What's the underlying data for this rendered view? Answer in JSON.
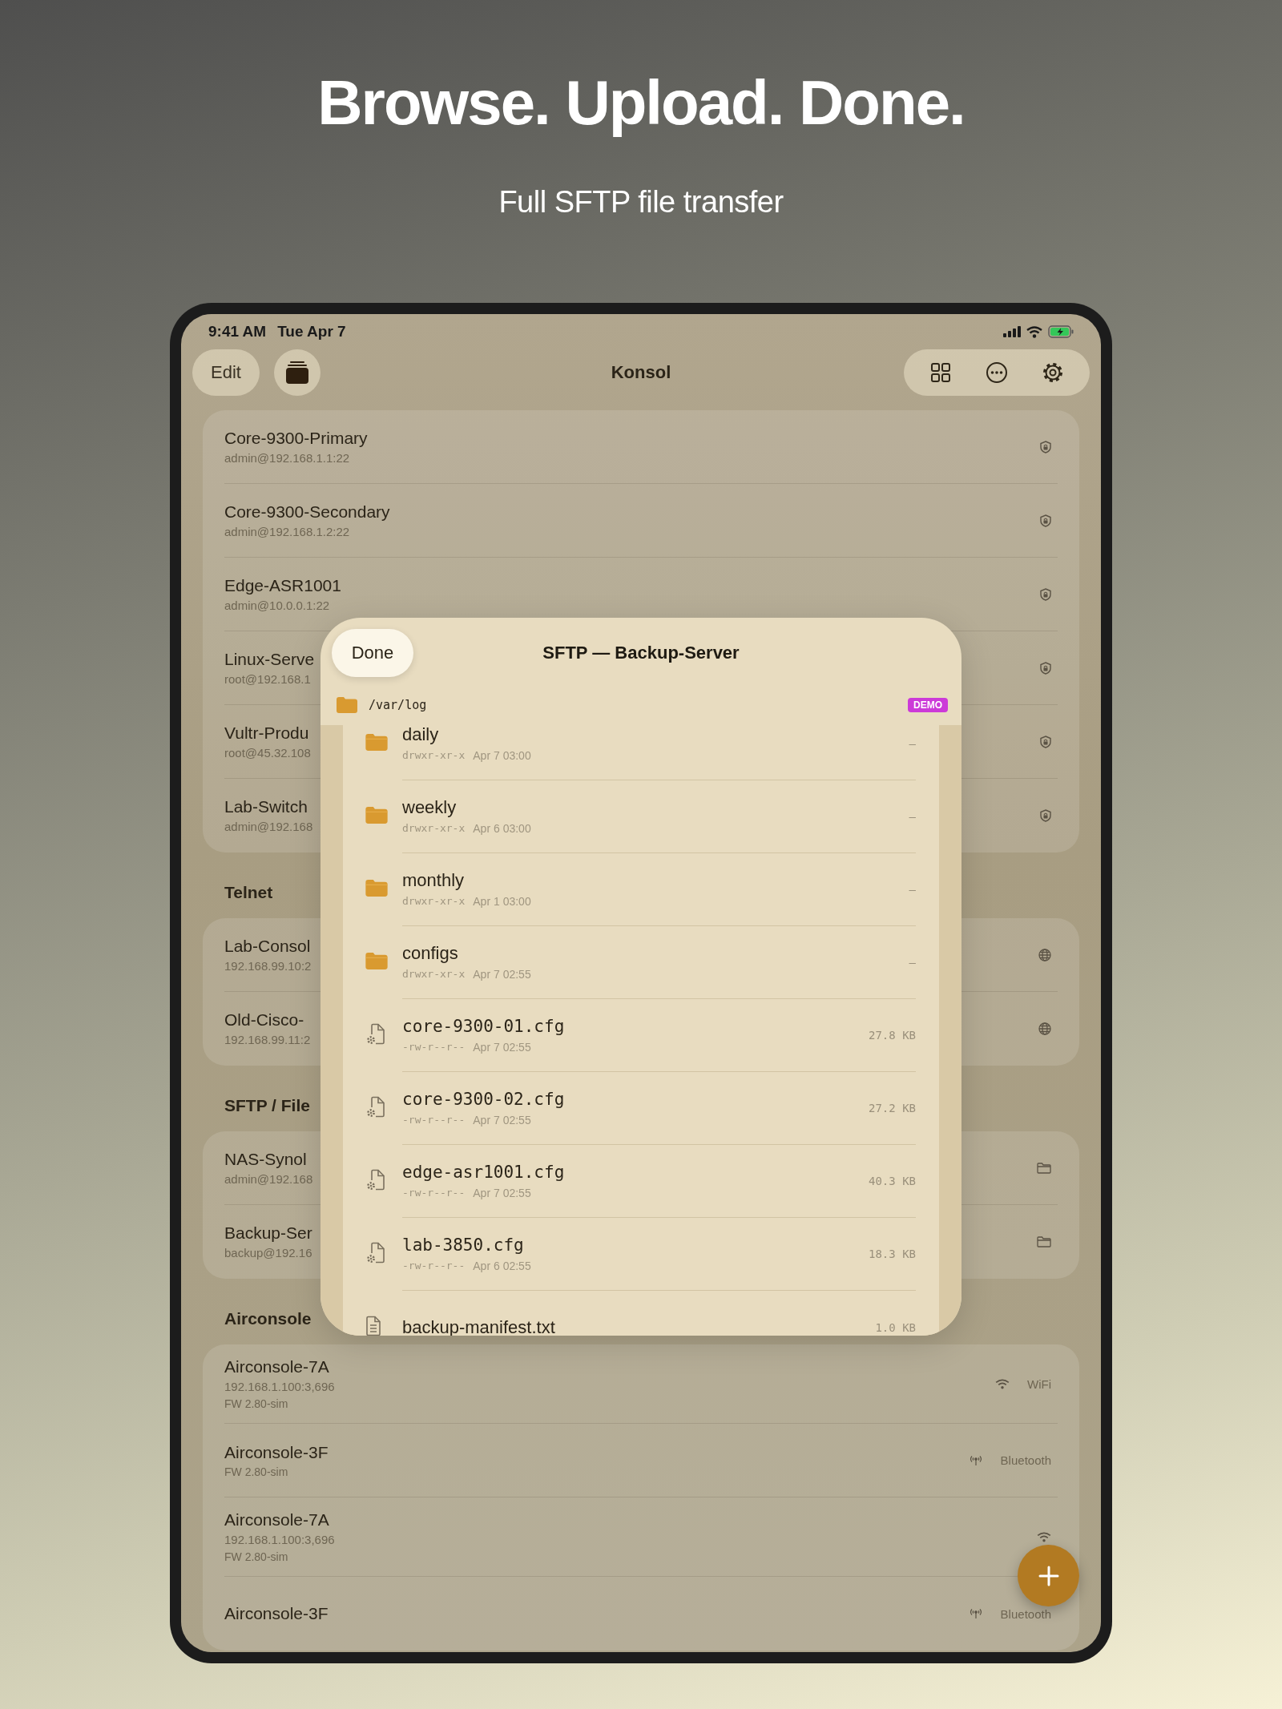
{
  "promo": {
    "headline": "Browse. Upload. Done.",
    "subtitle": "Full SFTP file transfer"
  },
  "status_bar": {
    "time": "9:41 AM",
    "date": "Tue Apr 7"
  },
  "nav_bar": {
    "edit_button": "Edit",
    "title": "Konsol"
  },
  "sections": [
    {
      "hosts": [
        {
          "name": "Core-9300-Primary",
          "address": "admin@192.168.1.1:22",
          "kind": "ssh"
        },
        {
          "name": "Core-9300-Secondary",
          "address": "admin@192.168.1.2:22",
          "kind": "ssh"
        },
        {
          "name": "Edge-ASR1001",
          "address": "admin@10.0.0.1:22",
          "kind": "ssh"
        },
        {
          "name": "Linux-Serve",
          "address": "root@192.168.1",
          "kind": "ssh"
        },
        {
          "name": "Vultr-Produ",
          "address": "root@45.32.108",
          "kind": "ssh"
        },
        {
          "name": "Lab-Switch",
          "address": "admin@192.168",
          "kind": "ssh"
        }
      ]
    },
    {
      "title": "Telnet",
      "hosts": [
        {
          "name": "Lab-Consol",
          "address": "192.168.99.10:2",
          "kind": "telnet"
        },
        {
          "name": "Old-Cisco-",
          "address": "192.168.99.11:2",
          "kind": "telnet"
        }
      ]
    },
    {
      "title": "SFTP / File",
      "hosts": [
        {
          "name": "NAS-Synol",
          "address": "admin@192.168",
          "kind": "sftp"
        },
        {
          "name": "Backup-Ser",
          "address": "backup@192.16",
          "kind": "sftp"
        }
      ]
    },
    {
      "title": "Airconsole",
      "hosts": [
        {
          "name": "Airconsole-7A",
          "address": "192.168.1.100:3,696",
          "firmware": "FW 2.80-sim",
          "kind": "wifi",
          "connection": "WiFi"
        },
        {
          "name": "Airconsole-3F",
          "firmware": "FW 2.80-sim",
          "kind": "bluetooth",
          "connection": "Bluetooth"
        },
        {
          "name": "Airconsole-7A",
          "address": "192.168.1.100:3,696",
          "firmware": "FW 2.80-sim",
          "kind": "wifi"
        },
        {
          "name": "Airconsole-3F",
          "kind": "bluetooth",
          "connection": "Bluetooth"
        }
      ]
    }
  ],
  "sftp_sheet": {
    "done_button": "Done",
    "title": "SFTP — Backup-Server",
    "path": "/var/log",
    "badge": "DEMO",
    "files": [
      {
        "kind": "folder",
        "name": "daily",
        "permissions": "drwxr-xr-x",
        "modified": "Apr 7 03:00",
        "size": "–"
      },
      {
        "kind": "folder",
        "name": "weekly",
        "permissions": "drwxr-xr-x",
        "modified": "Apr 6 03:00",
        "size": "–"
      },
      {
        "kind": "folder",
        "name": "monthly",
        "permissions": "drwxr-xr-x",
        "modified": "Apr 1 03:00",
        "size": "–"
      },
      {
        "kind": "folder",
        "name": "configs",
        "permissions": "drwxr-xr-x",
        "modified": "Apr 7 02:55",
        "size": "–"
      },
      {
        "kind": "config",
        "name": "core-9300-01.cfg",
        "permissions": "-rw-r--r--",
        "modified": "Apr 7 02:55",
        "size": "27.8 KB"
      },
      {
        "kind": "config",
        "name": "core-9300-02.cfg",
        "permissions": "-rw-r--r--",
        "modified": "Apr 7 02:55",
        "size": "27.2 KB"
      },
      {
        "kind": "config",
        "name": "edge-asr1001.cfg",
        "permissions": "-rw-r--r--",
        "modified": "Apr 7 02:55",
        "size": "40.3 KB"
      },
      {
        "kind": "config",
        "name": "lab-3850.cfg",
        "permissions": "-rw-r--r--",
        "modified": "Apr 6 02:55",
        "size": "18.3 KB"
      },
      {
        "kind": "text",
        "name": "backup-manifest.txt",
        "size": "1.0 KB"
      }
    ]
  }
}
